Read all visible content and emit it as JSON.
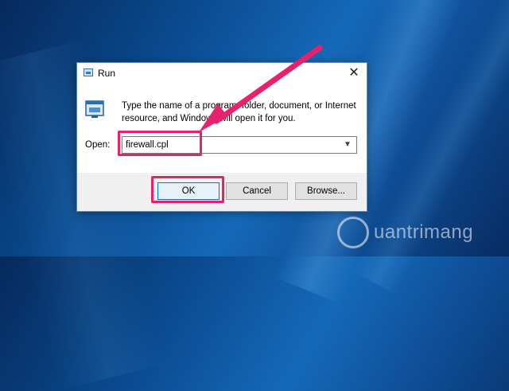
{
  "dialog": {
    "title": "Run",
    "description": "Type the name of a program, folder, document, or Internet resource, and Windows will open it for you.",
    "open_label": "Open:",
    "input_value": "firewall.cpl",
    "buttons": {
      "ok": "OK",
      "cancel": "Cancel",
      "browse": "Browse..."
    }
  },
  "annotations": {
    "highlight_color": "#e8216e"
  },
  "watermark": {
    "text": "uantrimang"
  },
  "icons": [
    "run-icon",
    "close-icon",
    "chevron-down-icon",
    "arrow-annotation-icon"
  ]
}
